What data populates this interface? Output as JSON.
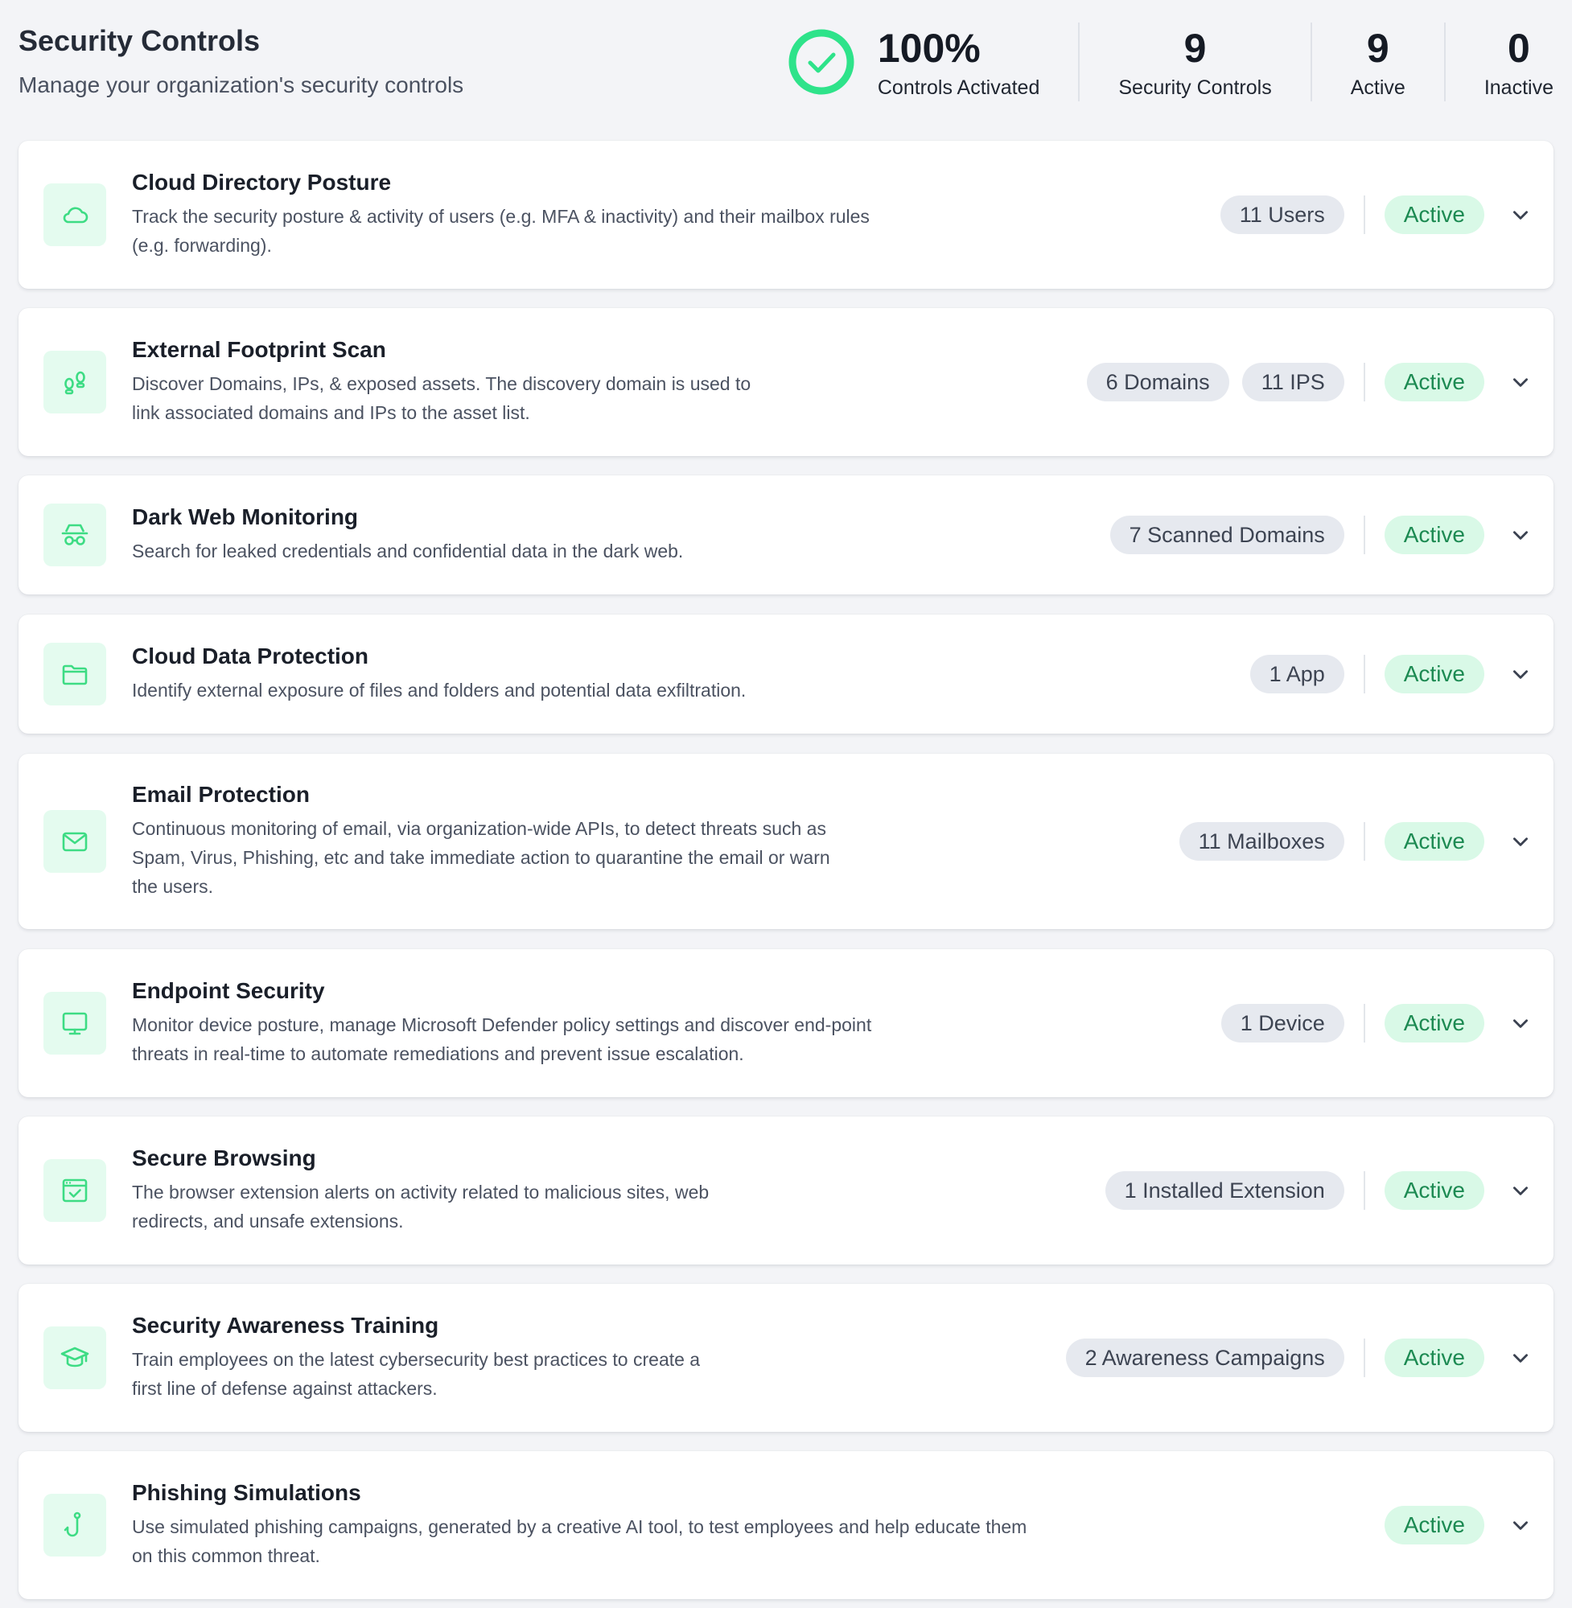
{
  "header": {
    "title": "Security Controls",
    "subtitle": "Manage your organization's security controls"
  },
  "stats": {
    "activated_percent": "100%",
    "activated_label": "Controls Activated",
    "activated_fraction": 1.0,
    "total_value": "9",
    "total_label": "Security Controls",
    "active_value": "9",
    "active_label": "Active",
    "inactive_value": "0",
    "inactive_label": "Inactive"
  },
  "colors": {
    "accent_green": "#2ee38a",
    "status_bg": "#d9f9e7",
    "status_text": "#1c8a52",
    "icon_bg": "#e4fbef",
    "pill_bg": "#e6e9ef"
  },
  "controls": [
    {
      "title": "Cloud Directory Posture",
      "desc_lines": [
        "Track the security posture & activity of users (e.g. MFA & inactivity) and their mailbox rules",
        "(e.g. forwarding)."
      ],
      "pills": [
        "11 Users"
      ],
      "status": "Active",
      "icon": "cloud-icon"
    },
    {
      "title": "External Footprint Scan",
      "desc_lines": [
        "Discover Domains, IPs, & exposed assets. The discovery domain is used to",
        "link associated domains and IPs to the asset list."
      ],
      "pills": [
        "6 Domains",
        "11 IPS"
      ],
      "status": "Active",
      "icon": "footprints-icon"
    },
    {
      "title": "Dark Web Monitoring",
      "desc_lines": [
        "Search for leaked credentials and confidential data in the dark web."
      ],
      "pills": [
        "7 Scanned Domains"
      ],
      "status": "Active",
      "icon": "spy-icon"
    },
    {
      "title": "Cloud Data Protection",
      "desc_lines": [
        "Identify external exposure of files and folders and potential data exfiltration."
      ],
      "pills": [
        "1 App"
      ],
      "status": "Active",
      "icon": "folder-icon"
    },
    {
      "title": "Email Protection",
      "desc_lines": [
        "Continuous monitoring of email, via organization-wide APIs, to detect threats such as",
        "Spam, Virus, Phishing, etc and take immediate action to quarantine the email or warn",
        "the users."
      ],
      "pills": [
        "11 Mailboxes"
      ],
      "status": "Active",
      "icon": "envelope-icon"
    },
    {
      "title": "Endpoint Security",
      "desc_lines": [
        "Monitor device posture, manage Microsoft Defender policy settings and discover end-point",
        "threats in real-time to automate remediations and prevent issue escalation."
      ],
      "pills": [
        "1 Device"
      ],
      "status": "Active",
      "icon": "monitor-icon"
    },
    {
      "title": "Secure Browsing",
      "desc_lines": [
        "The browser extension alerts on activity related to malicious sites, web",
        "redirects, and unsafe extensions."
      ],
      "pills": [
        "1 Installed Extension"
      ],
      "status": "Active",
      "icon": "browser-check-icon"
    },
    {
      "title": "Security Awareness Training",
      "desc_lines": [
        "Train employees on the latest cybersecurity best practices to create a",
        "first line of defense against attackers."
      ],
      "pills": [
        "2 Awareness Campaigns"
      ],
      "status": "Active",
      "icon": "graduation-cap-icon"
    },
    {
      "title": "Phishing Simulations",
      "desc_lines": [
        "Use simulated phishing campaigns, generated by a creative AI tool, to test employees and help educate them",
        "on this common threat."
      ],
      "pills": [],
      "status": "Active",
      "icon": "fishing-hook-icon"
    }
  ]
}
